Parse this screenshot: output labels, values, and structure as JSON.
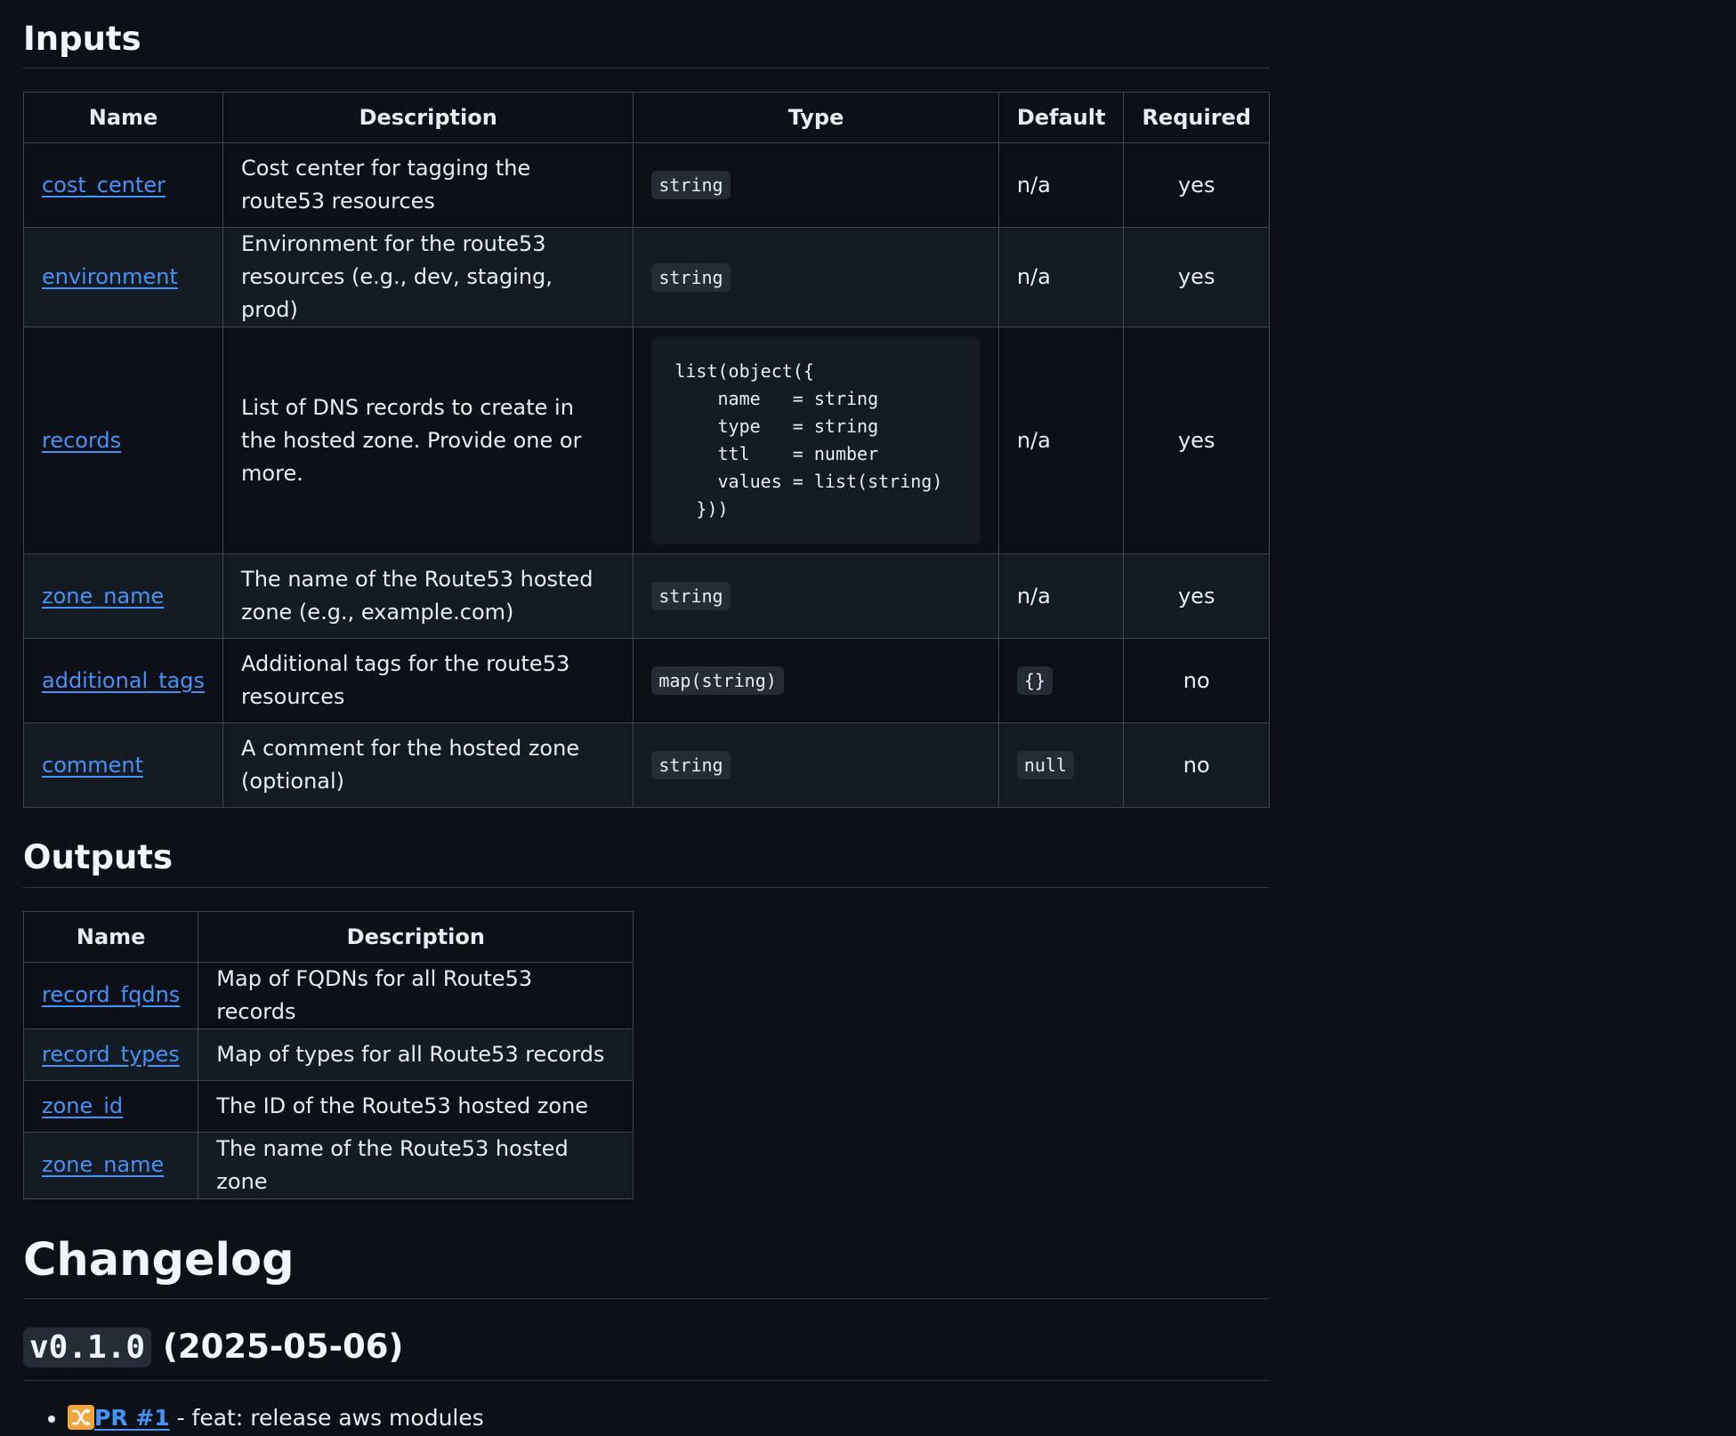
{
  "inputs": {
    "heading": "Inputs",
    "headers": [
      "Name",
      "Description",
      "Type",
      "Default",
      "Required"
    ],
    "rows": [
      {
        "name": "cost_center",
        "description": "Cost center for tagging the route53 resources",
        "type": "string",
        "default": "n/a",
        "required": "yes"
      },
      {
        "name": "environment",
        "description": "Environment for the route53 resources (e.g., dev, staging, prod)",
        "type": "string",
        "default": "n/a",
        "required": "yes"
      },
      {
        "name": "records",
        "description": "List of DNS records to create in the hosted zone. Provide one or more.",
        "type": "list(object({\n    name   = string\n    type   = string\n    ttl    = number\n    values = list(string)\n  }))",
        "default": "n/a",
        "required": "yes"
      },
      {
        "name": "zone_name",
        "description": "The name of the Route53 hosted zone (e.g., example.com)",
        "type": "string",
        "default": "n/a",
        "required": "yes"
      },
      {
        "name": "additional_tags",
        "description": "Additional tags for the route53 resources",
        "type": "map(string)",
        "default": "{}",
        "required": "no"
      },
      {
        "name": "comment",
        "description": "A comment for the hosted zone (optional)",
        "type": "string",
        "default": "null",
        "required": "no"
      }
    ]
  },
  "outputs": {
    "heading": "Outputs",
    "headers": [
      "Name",
      "Description"
    ],
    "rows": [
      {
        "name": "record_fqdns",
        "description": "Map of FQDNs for all Route53 records"
      },
      {
        "name": "record_types",
        "description": "Map of types for all Route53 records"
      },
      {
        "name": "zone_id",
        "description": "The ID of the Route53 hosted zone"
      },
      {
        "name": "zone_name",
        "description": "The name of the Route53 hosted zone"
      }
    ]
  },
  "changelog": {
    "heading": "Changelog",
    "version": "v0.1.0",
    "date": "(2025-05-06)",
    "items": [
      {
        "icon": "merge-icon",
        "link": "PR #1",
        "text": " - feat: release aws modules"
      }
    ]
  }
}
